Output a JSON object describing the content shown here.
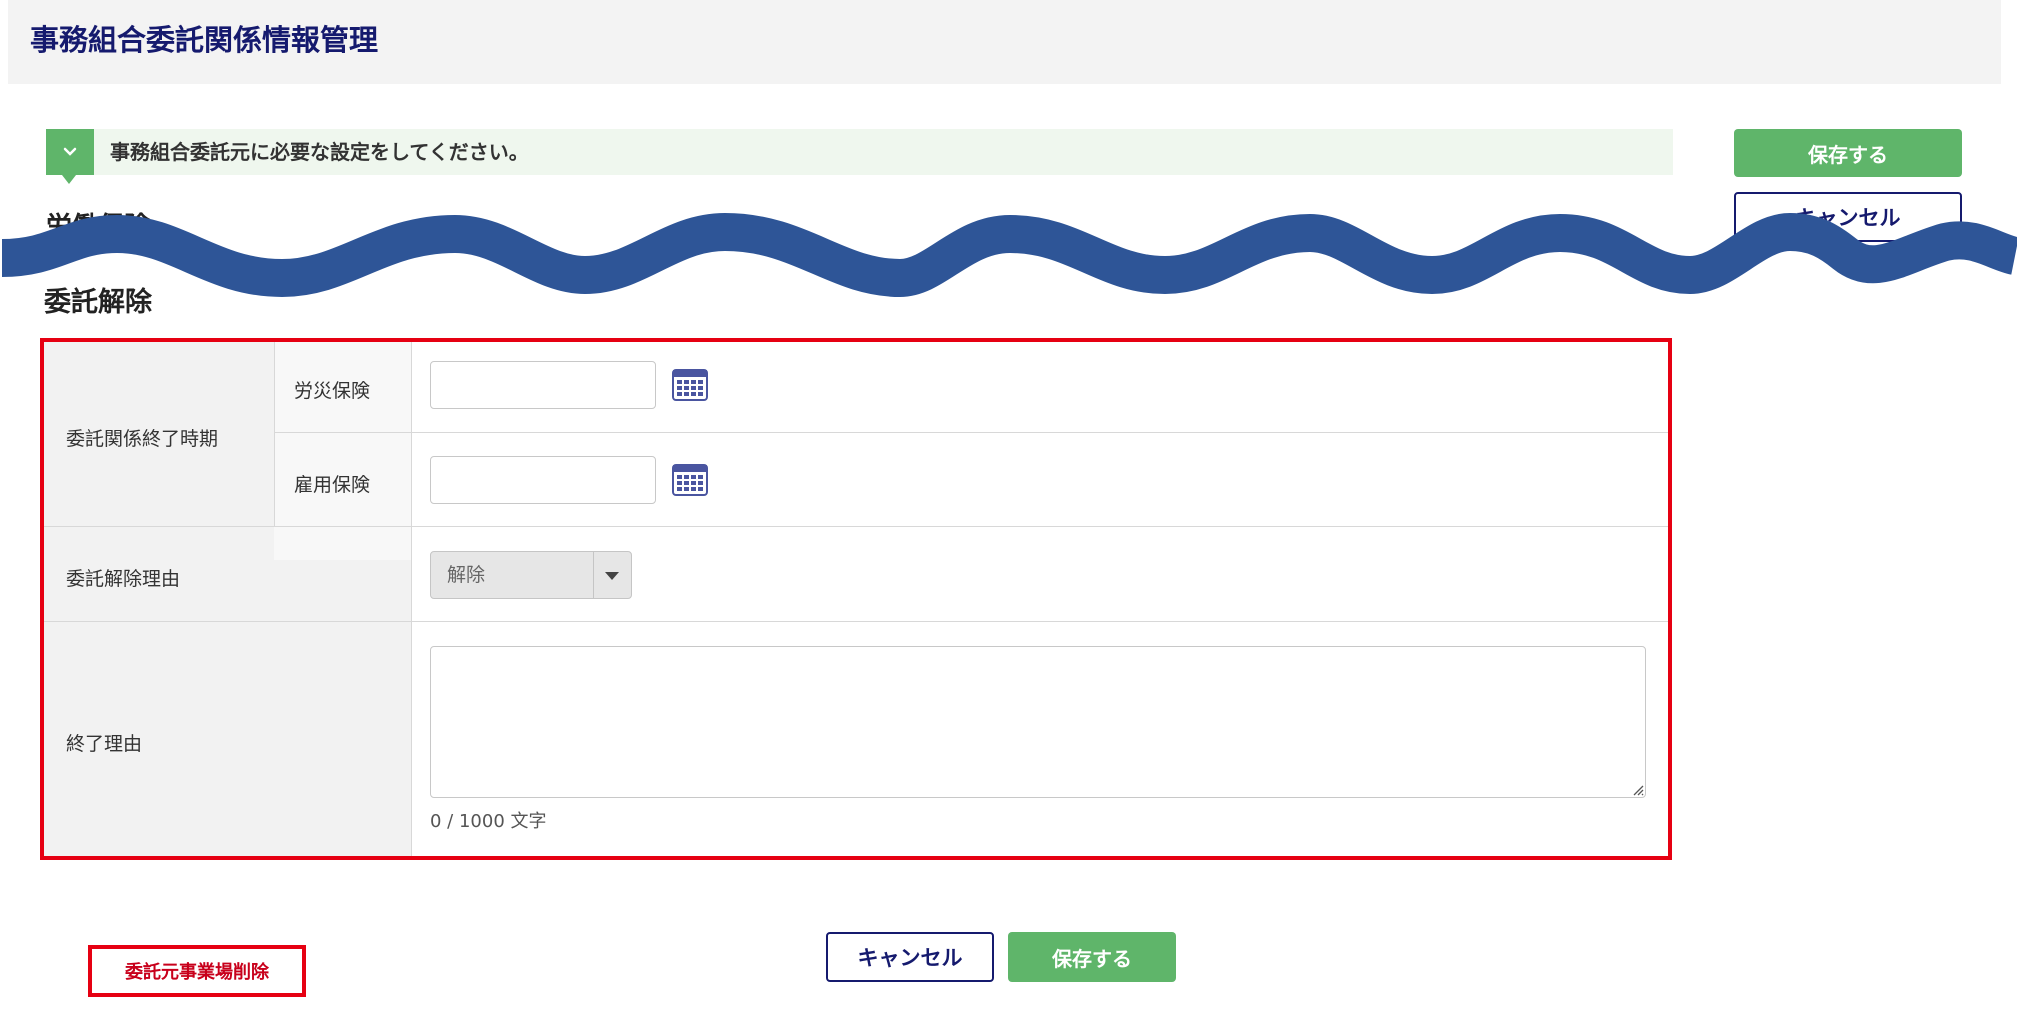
{
  "header": {
    "title": "事務組合委託関係情報管理"
  },
  "info": {
    "message": "事務組合委託元に必要な設定をしてください。"
  },
  "actions": {
    "save_label": "保存する",
    "cancel_label": "キャンセル"
  },
  "sections": {
    "labor_insurance": "労働保険",
    "entrustment_cancel": "委託解除"
  },
  "form": {
    "end_period_label": "委託関係終了時期",
    "workers_comp_label": "労災保険",
    "workers_comp_value": "",
    "employment_label": "雇用保険",
    "employment_value": "",
    "cancel_reason_label": "委託解除理由",
    "cancel_reason_selected": "解除",
    "end_reason_label": "終了理由",
    "end_reason_value": "",
    "char_count": "0 / 1000 文字"
  },
  "footer": {
    "delete_label": "委託元事業場削除",
    "cancel_label": "キャンセル",
    "save_label": "保存する"
  },
  "colors": {
    "title": "#151a6e",
    "accent_green": "#5fb56a",
    "highlight_red": "#e60012",
    "wave_blue": "#2e5597"
  }
}
